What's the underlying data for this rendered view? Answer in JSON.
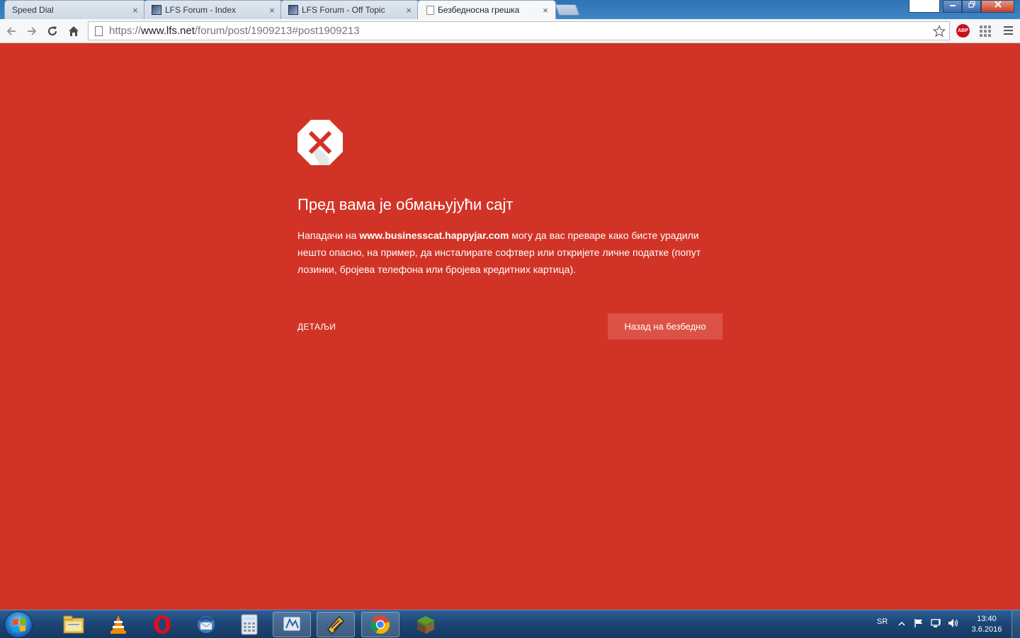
{
  "browser": {
    "tabs": [
      {
        "title": "Speed Dial",
        "favicon": "none",
        "active": false
      },
      {
        "title": "LFS Forum - Index",
        "favicon": "lfs-icon",
        "active": false
      },
      {
        "title": "LFS Forum - Off Topic",
        "favicon": "lfs-icon",
        "active": false
      },
      {
        "title": "Безбедносна грешка",
        "favicon": "page-icon",
        "active": true
      }
    ],
    "close_glyph": "×",
    "url": {
      "scheme": "https://",
      "host": "www.lfs.net",
      "path": "/forum/post/1909213#post1909213"
    },
    "abp_label": "ABP"
  },
  "interstitial": {
    "heading": "Пред вама је обмањујући сајт",
    "explanation_prefix": "Нападачи на ",
    "explanation_domain": "www.businesscat.happyjar.com",
    "explanation_suffix": " могу да вас преваре како бисте урадили нешто опасно, на пример, да инсталирате софтвер или откријете личне податке (попут лозинки, бројева телефона или бројева кредитних картица).",
    "details_label": "ДЕТАЉИ",
    "back_button_label": "Назад на безбедно",
    "background_color": "#d13426"
  },
  "taskbar": {
    "items": [
      "windows-explorer-icon",
      "vlc-icon",
      "opera-icon",
      "thunderbird-icon",
      "calculator-icon",
      "app-icon",
      "winamp-icon",
      "chrome-icon",
      "minecraft-icon"
    ],
    "language": "SR",
    "time": "13:40",
    "date": "3.6.2016"
  }
}
